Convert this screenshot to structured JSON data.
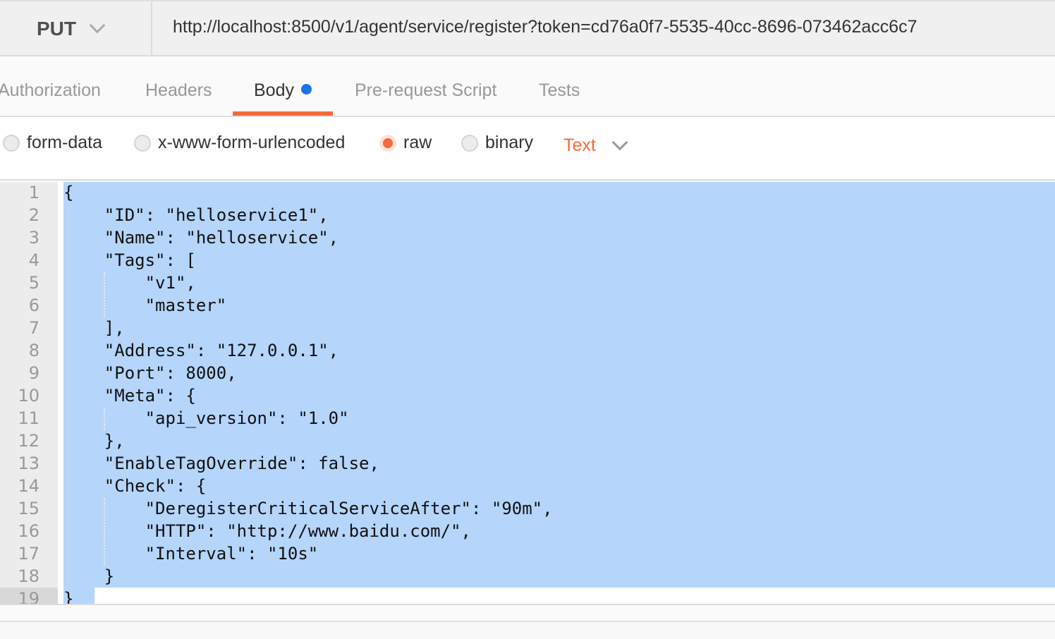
{
  "request": {
    "method": "PUT",
    "url": "http://localhost:8500/v1/agent/service/register?token=cd76a0f7-5535-40cc-8696-073462acc6c7"
  },
  "tabs": [
    {
      "label": "Authorization"
    },
    {
      "label": "Headers"
    },
    {
      "label": "Body",
      "active": true,
      "has_content": true
    },
    {
      "label": "Pre-request Script"
    },
    {
      "label": "Tests"
    }
  ],
  "body_types": [
    {
      "label": "form-data"
    },
    {
      "label": "x-www-form-urlencoded"
    },
    {
      "label": "raw",
      "selected": true
    },
    {
      "label": "binary"
    }
  ],
  "content_type": "Text",
  "colors": {
    "accent": "#f26b3a",
    "selection": "#b5d5fb",
    "dot": "#1a73e8"
  },
  "editor": {
    "lines": [
      "{",
      "    \"ID\": \"helloservice1\",",
      "    \"Name\": \"helloservice\",",
      "    \"Tags\": [",
      "        \"v1\",",
      "        \"master\"",
      "    ],",
      "    \"Address\": \"127.0.0.1\",",
      "    \"Port\": 8000,",
      "    \"Meta\": {",
      "        \"api_version\": \"1.0\"",
      "    },",
      "    \"EnableTagOverride\": false,",
      "    \"Check\": {",
      "        \"DeregisterCriticalServiceAfter\": \"90m\",",
      "        \"HTTP\": \"http://www.baidu.com/\",",
      "        \"Interval\": \"10s\"",
      "    }",
      "}"
    ]
  }
}
